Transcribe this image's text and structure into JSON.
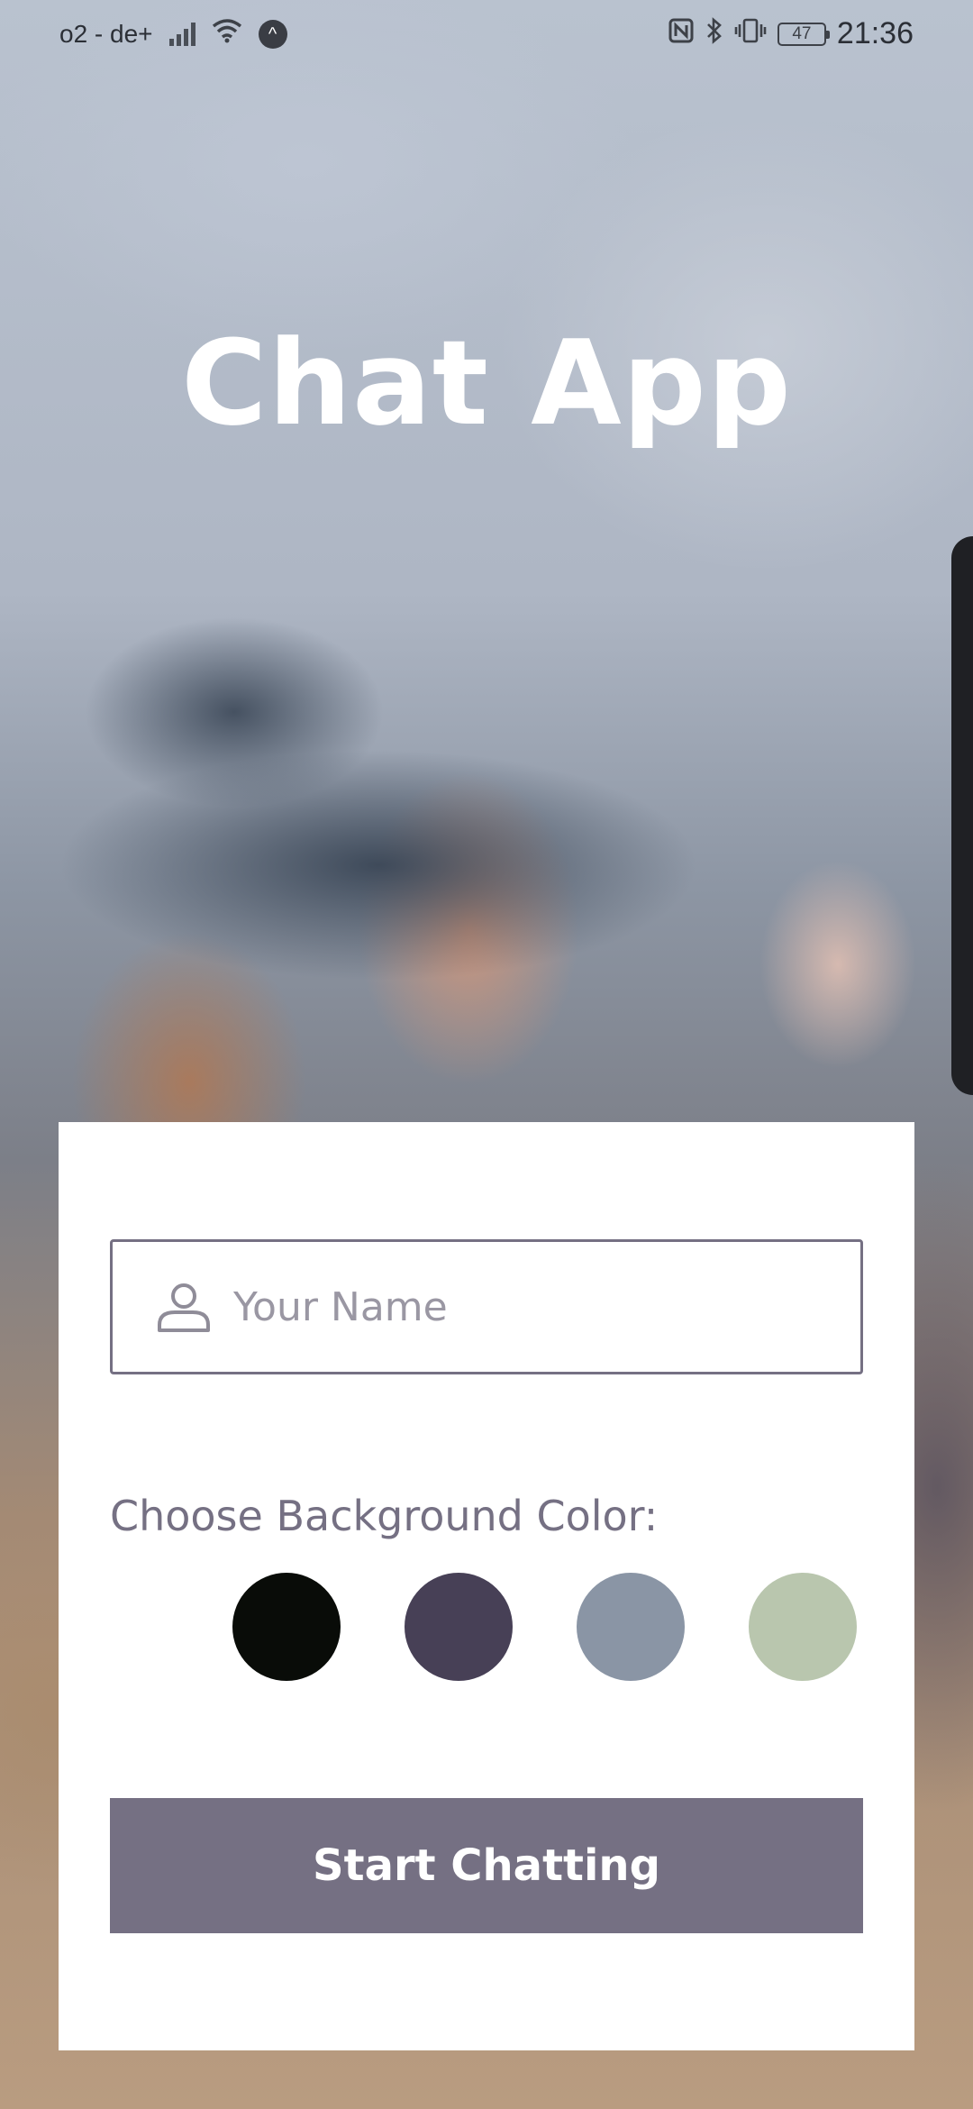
{
  "status_bar": {
    "carrier": "o2 - de+",
    "network_badge": "^",
    "battery_level": "47",
    "time": "21:36",
    "icons": [
      "signal-icon",
      "wifi-icon",
      "nfc-icon",
      "bluetooth-icon",
      "vibrate-icon",
      "battery-icon"
    ]
  },
  "app": {
    "title": "Chat App"
  },
  "form": {
    "name_placeholder": "Your Name",
    "name_value": "",
    "color_label": "Choose Background Color:",
    "colors": [
      {
        "name": "black",
        "hex": "#090C08"
      },
      {
        "name": "purple",
        "hex": "#474056"
      },
      {
        "name": "grey",
        "hex": "#8A95A5"
      },
      {
        "name": "green",
        "hex": "#B9C6AE"
      }
    ],
    "start_button_label": "Start Chatting",
    "accent_color": "#757083"
  }
}
